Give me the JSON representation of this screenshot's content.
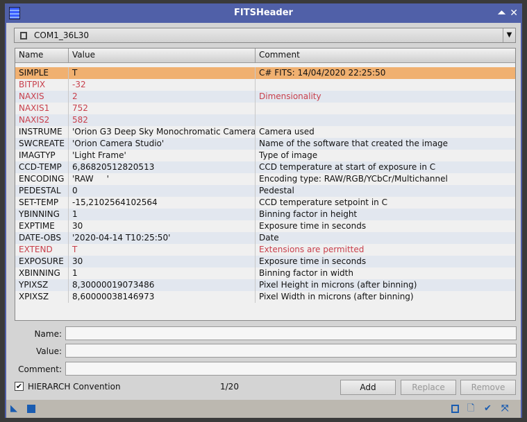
{
  "window": {
    "title": "FITSHeader"
  },
  "combo": {
    "selected": "COM1_36L30"
  },
  "table": {
    "columns": [
      "Name",
      "Value",
      "Comment"
    ],
    "rows": [
      {
        "name": "SIMPLE",
        "value": "T",
        "comment": "C# FITS: 14/04/2020 22:25:50",
        "state": "selected"
      },
      {
        "name": "BITPIX",
        "value": "-32",
        "comment": "",
        "state": "reserved"
      },
      {
        "name": "NAXIS",
        "value": "2",
        "comment": "Dimensionality",
        "state": "reserved"
      },
      {
        "name": "NAXIS1",
        "value": "752",
        "comment": "",
        "state": "reserved"
      },
      {
        "name": "NAXIS2",
        "value": "582",
        "comment": "",
        "state": "reserved"
      },
      {
        "name": "INSTRUME",
        "value": "'Orion G3 Deep Sky Monochromatic Camera'",
        "comment": "Camera used",
        "state": ""
      },
      {
        "name": "SWCREATE",
        "value": "'Orion Camera Studio'",
        "comment": "Name of the software that created the image",
        "state": ""
      },
      {
        "name": "IMAGTYP",
        "value": "'Light Frame'",
        "comment": "Type of image",
        "state": ""
      },
      {
        "name": "CCD-TEMP",
        "value": "6,86820512820513",
        "comment": "CCD temperature at start of exposure in C",
        "state": ""
      },
      {
        "name": "ENCODING",
        "value": "'RAW     '",
        "comment": "Encoding type: RAW/RGB/YCbCr/Multichannel",
        "state": ""
      },
      {
        "name": "PEDESTAL",
        "value": "0",
        "comment": "Pedestal",
        "state": ""
      },
      {
        "name": "SET-TEMP",
        "value": "-15,2102564102564",
        "comment": "CCD temperature setpoint in C",
        "state": ""
      },
      {
        "name": "YBINNING",
        "value": "1",
        "comment": "Binning factor in height",
        "state": ""
      },
      {
        "name": "EXPTIME",
        "value": "30",
        "comment": "Exposure time in seconds",
        "state": ""
      },
      {
        "name": "DATE-OBS",
        "value": "'2020-04-14 T10:25:50'",
        "comment": "Date",
        "state": ""
      },
      {
        "name": "EXTEND",
        "value": "T",
        "comment": "Extensions are permitted",
        "state": "reserved"
      },
      {
        "name": "EXPOSURE",
        "value": "30",
        "comment": "Exposure time in seconds",
        "state": ""
      },
      {
        "name": "XBINNING",
        "value": "1",
        "comment": "Binning factor in width",
        "state": ""
      },
      {
        "name": "YPIXSZ",
        "value": "8,30000019073486",
        "comment": "Pixel Height in microns (after binning)",
        "state": ""
      },
      {
        "name": "XPIXSZ",
        "value": "8,60000038146973",
        "comment": "Pixel Width in microns (after binning)",
        "state": ""
      }
    ]
  },
  "form": {
    "name_label": "Name:",
    "value_label": "Value:",
    "comment_label": "Comment:",
    "name": "",
    "value": "",
    "comment": ""
  },
  "bottom": {
    "hierarch_label": "HIERARCH Convention",
    "hierarch_checked": true,
    "counter": "1/20",
    "add": "Add",
    "replace": "Replace",
    "remove": "Remove"
  },
  "colors": {
    "title_bar": "#5060a8",
    "selected": "#f0b070",
    "reserved_text": "#c8404c"
  }
}
